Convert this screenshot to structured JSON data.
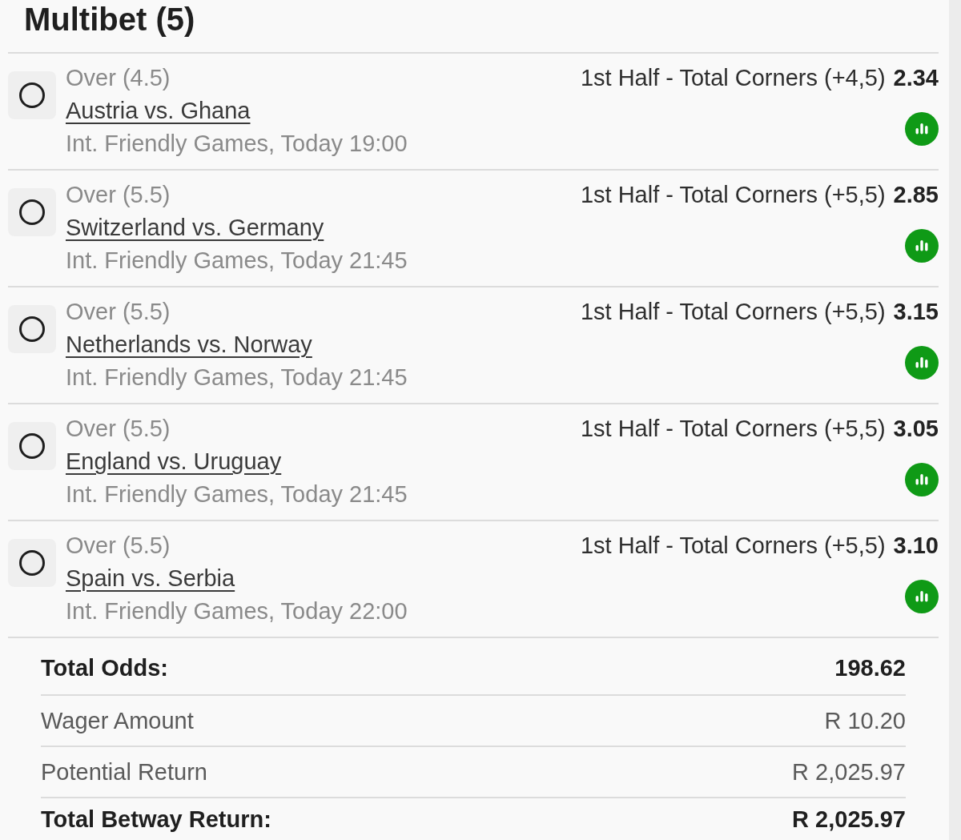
{
  "header": {
    "title": "Multibet (5)"
  },
  "legs": [
    {
      "selection": "Over (4.5)",
      "match": "Austria vs. Ghana",
      "league_time": "Int. Friendly Games, Today 19:00",
      "market": "1st Half - Total Corners (+4,5)",
      "odds": "2.34",
      "selected": false
    },
    {
      "selection": "Over (5.5)",
      "match": "Switzerland vs. Germany",
      "league_time": "Int. Friendly Games, Today 21:45",
      "market": "1st Half - Total Corners (+5,5)",
      "odds": "2.85",
      "selected": false
    },
    {
      "selection": "Over (5.5)",
      "match": "Netherlands vs. Norway",
      "league_time": "Int. Friendly Games, Today 21:45",
      "market": "1st Half - Total Corners (+5,5)",
      "odds": "3.15",
      "selected": false
    },
    {
      "selection": "Over (5.5)",
      "match": "England vs. Uruguay",
      "league_time": "Int. Friendly Games, Today 21:45",
      "market": "1st Half - Total Corners (+5,5)",
      "odds": "3.05",
      "selected": false
    },
    {
      "selection": "Over (5.5)",
      "match": "Spain vs. Serbia",
      "league_time": "Int. Friendly Games, Today 22:00",
      "market": "1st Half - Total Corners (+5,5)",
      "odds": "3.10",
      "selected": false
    }
  ],
  "summary": [
    {
      "kind": "total",
      "label": "Total Odds:",
      "value": "198.62"
    },
    {
      "kind": "detail",
      "label": "Wager Amount",
      "value": "R 10.20"
    },
    {
      "kind": "detail",
      "label": "Potential Return",
      "value": "R 2,025.97"
    },
    {
      "kind": "total",
      "label": "Total Betway Return:",
      "value": "R 2,025.97"
    }
  ]
}
